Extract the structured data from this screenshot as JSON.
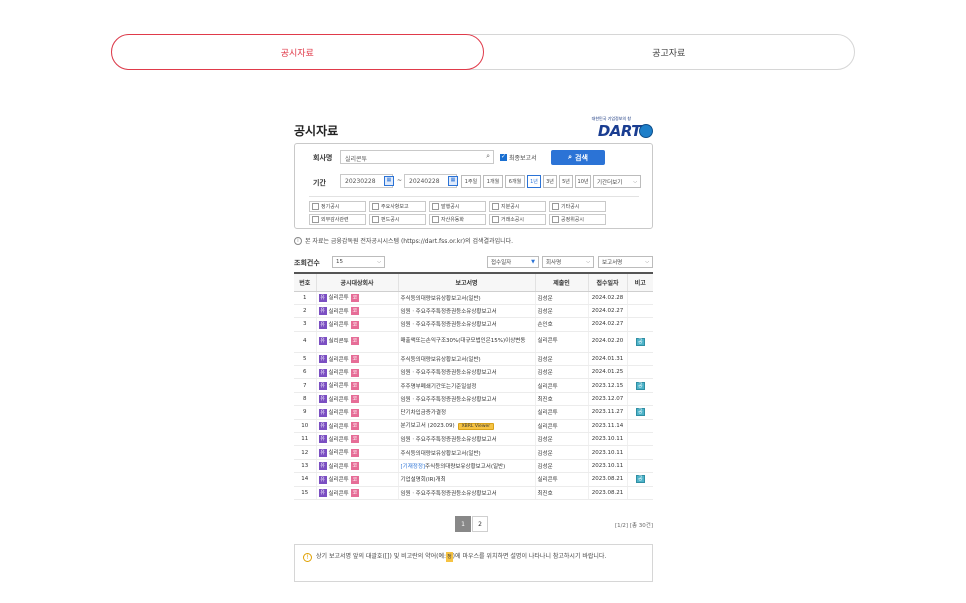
{
  "tabs": [
    {
      "label": "공시자료",
      "active": true
    },
    {
      "label": "공고자료",
      "active": false
    }
  ],
  "panel": {
    "title": "공시자료",
    "logo": {
      "sub": "대한민국 기업정보의 창",
      "text": "DART"
    }
  },
  "search": {
    "company_label": "회사명",
    "company_value": "실리콘투",
    "final_report_label": "최종보고서",
    "final_report_checked": true,
    "search_button": "검색",
    "period_label": "기간",
    "start_date": "20230228",
    "end_date": "20240228",
    "date_sep": "~",
    "ranges": [
      "1주일",
      "1개월",
      "6개월",
      "1년",
      "3년",
      "5년",
      "10년"
    ],
    "selected_range": "1년",
    "period_select": "기간더보기",
    "categories": [
      "정기공시",
      "주요사항보고",
      "발행공시",
      "지분공시",
      "기타공시",
      "외부감사관련",
      "펀드공시",
      "자산유동화",
      "거래소공시",
      "공정위공시"
    ]
  },
  "notice": "본 자료는 금융감독원 전자공시시스템 (https://dart.fss.or.kr)의 검색결과입니다.",
  "count": {
    "label": "조회건수",
    "value": "15",
    "sort_options": [
      "접수일자",
      "회사명",
      "보고서명"
    ]
  },
  "table": {
    "headers": [
      "번호",
      "공시대상회사",
      "보고서명",
      "제출인",
      "접수일자",
      "비고"
    ],
    "company": "실리콘투",
    "company_icon": "유",
    "company_badge": "코",
    "rows": [
      {
        "no": "1",
        "report": "주식등의대량보유상황보고서(일반)",
        "submitter": "김성운",
        "date": "2024.02.28",
        "note": false
      },
      {
        "no": "2",
        "report": "임원ㆍ주요주주특정증권등소유상황보고서",
        "submitter": "김성운",
        "date": "2024.02.27",
        "note": false
      },
      {
        "no": "3",
        "report": "임원ㆍ주요주주특정증권등소유상황보고서",
        "submitter": "손인호",
        "date": "2024.02.27",
        "note": false
      },
      {
        "no": "4",
        "report": "매출액또는손익구조30%(대규모법인은15%)이상변동",
        "submitter": "실리콘투",
        "date": "2024.02.20",
        "note": true
      },
      {
        "no": "5",
        "report": "주식등의대량보유상황보고서(일반)",
        "submitter": "김성운",
        "date": "2024.01.31",
        "note": false
      },
      {
        "no": "6",
        "report": "임원ㆍ주요주주특정증권등소유상황보고서",
        "submitter": "김성운",
        "date": "2024.01.25",
        "note": false
      },
      {
        "no": "7",
        "report": "주주명부폐쇄기간또는기준일설정",
        "submitter": "실리콘투",
        "date": "2023.12.15",
        "note": true
      },
      {
        "no": "8",
        "report": "임원ㆍ주요주주특정증권등소유상황보고서",
        "submitter": "최진호",
        "date": "2023.12.07",
        "note": false
      },
      {
        "no": "9",
        "report": "단기차입금증가결정",
        "submitter": "실리콘투",
        "date": "2023.11.27",
        "note": true
      },
      {
        "no": "10",
        "report": "분기보고서 (2023.09)",
        "xbrl": "XBRL Viewer",
        "submitter": "실리콘투",
        "date": "2023.11.14",
        "note": false
      },
      {
        "no": "11",
        "report": "임원ㆍ주요주주특정증권등소유상황보고서",
        "submitter": "김성운",
        "date": "2023.10.11",
        "note": false
      },
      {
        "no": "12",
        "report": "주식등의대량보유상황보고서(일반)",
        "submitter": "김성운",
        "date": "2023.10.11",
        "note": false
      },
      {
        "no": "13",
        "prefix": "[기재정정]",
        "report": "주식등의대량보유상황보고서(일반)",
        "submitter": "김성운",
        "date": "2023.10.11",
        "note": false
      },
      {
        "no": "14",
        "report": "기업설명회(IR)개최",
        "submitter": "실리콘투",
        "date": "2023.08.21",
        "note": true
      },
      {
        "no": "15",
        "report": "임원ㆍ주요주주특정증권등소유상황보고서",
        "submitter": "최진호",
        "date": "2023.08.21",
        "note": false
      }
    ],
    "note_icon": "공"
  },
  "pagination": {
    "pages": [
      "1",
      "2"
    ],
    "current": "1",
    "info": "[1/2] [총 30건]"
  },
  "tip": {
    "before": "상기 보고서명 앞의 대괄호([]) 및 비고란의 약어(예:",
    "badge": "정",
    "after": ")에 마우스를 위치하면 설명이 나타나니 참고하시기 바랍니다."
  }
}
